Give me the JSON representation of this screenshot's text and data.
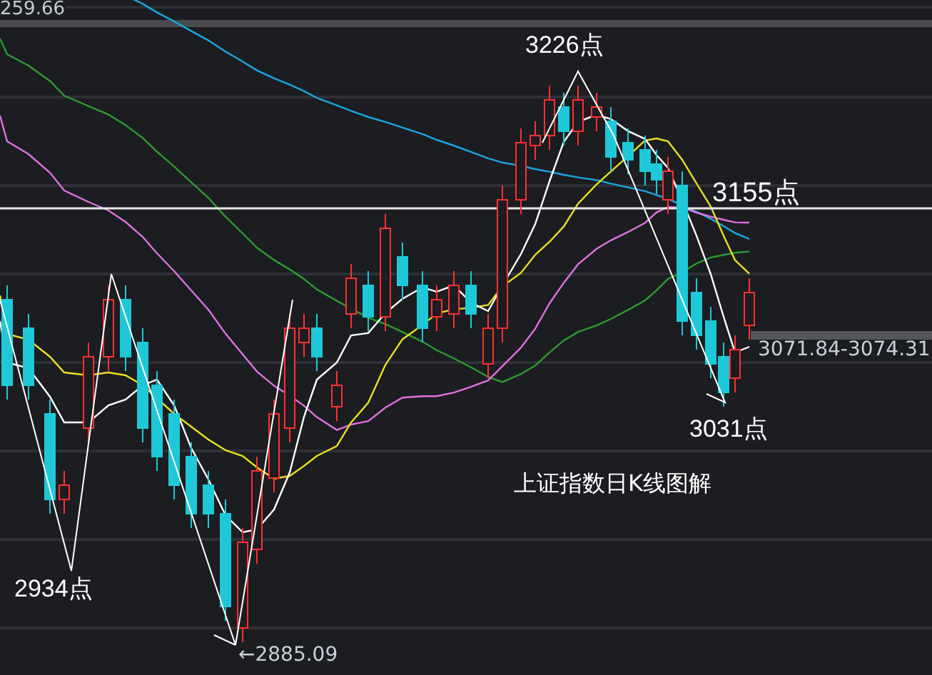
{
  "chart": {
    "axis_label": "259.66",
    "annotations": [
      {
        "kind": "point",
        "text": "3226点"
      },
      {
        "kind": "line",
        "text": "3155点"
      },
      {
        "kind": "readout",
        "text": "3071.84-3074.31"
      },
      {
        "kind": "point",
        "text": "3031点"
      },
      {
        "kind": "point",
        "text": "2934点"
      },
      {
        "kind": "readout",
        "text": "←2885.09"
      }
    ],
    "caption": "上证指数日K线图解"
  }
}
